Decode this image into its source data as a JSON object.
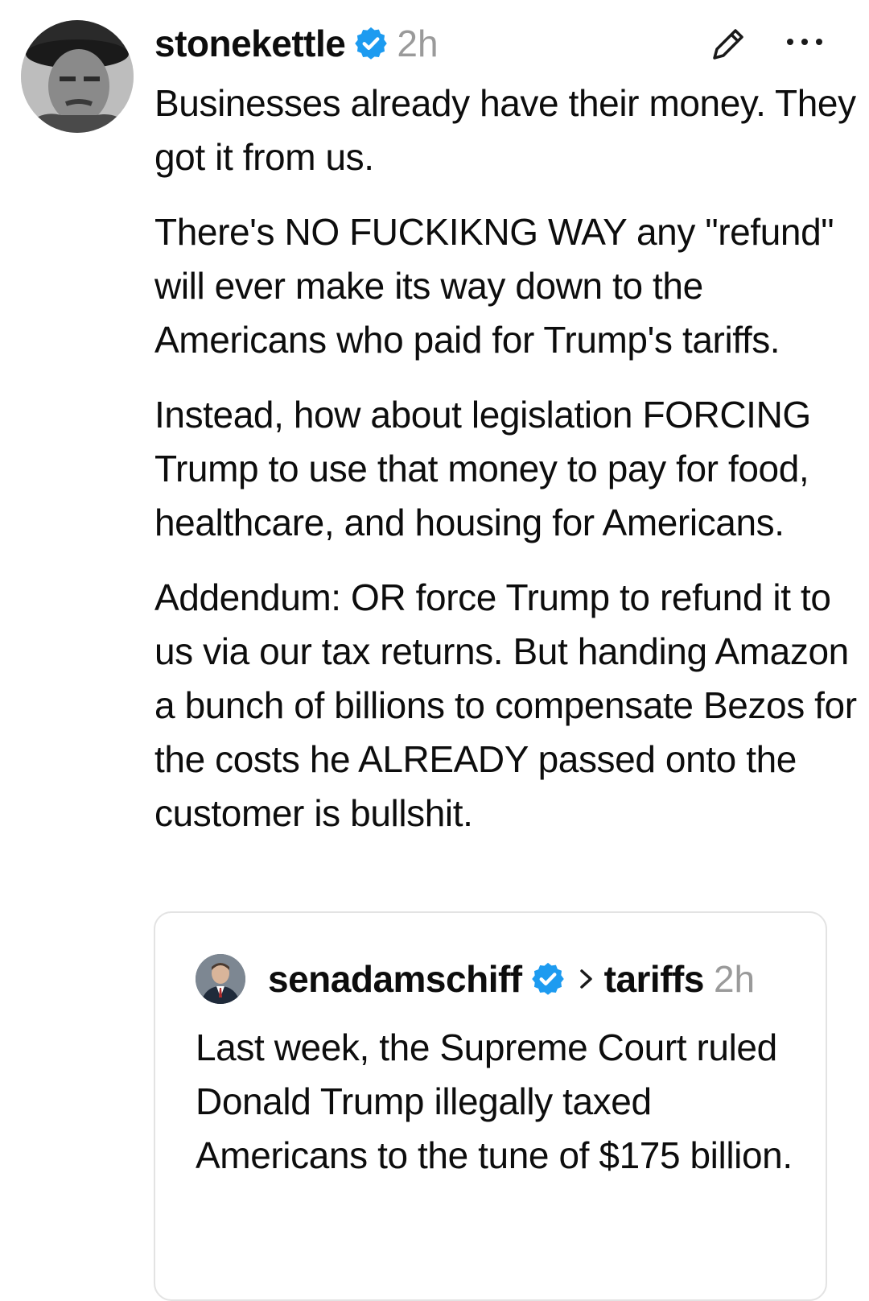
{
  "post": {
    "username": "stonekettle",
    "time": "2h",
    "paragraphs": [
      "Businesses already have their money. They got it from us.",
      "There's NO FUCKIKNG WAY any \"refund\" will ever make its way down to the Americans who paid for Trump's tariffs.",
      "Instead, how about legislation FORCING Trump to use that money to pay for food, healthcare, and housing for Americans.",
      "Addendum: OR force Trump to refund it to us via our tax returns. But handing Amazon a bunch of billions to compensate Bezos for the costs he ALREADY passed onto the customer is bullshit."
    ]
  },
  "quoted_post": {
    "username": "senadamschiff",
    "topic": "tariffs",
    "time": "2h",
    "text": "Last week, the Supreme Court ruled Donald Trump illegally taxed Americans to the tune of $175 billion."
  },
  "icons": {
    "verified": "verified-badge-icon",
    "edit": "pencil-icon",
    "more": "more-options-icon",
    "chevron": "chevron-right-icon"
  },
  "colors": {
    "verified_blue": "#1d9bf0",
    "muted_text": "#9a9a9a",
    "text": "#0d0d0d",
    "border": "#e3e3e3"
  }
}
